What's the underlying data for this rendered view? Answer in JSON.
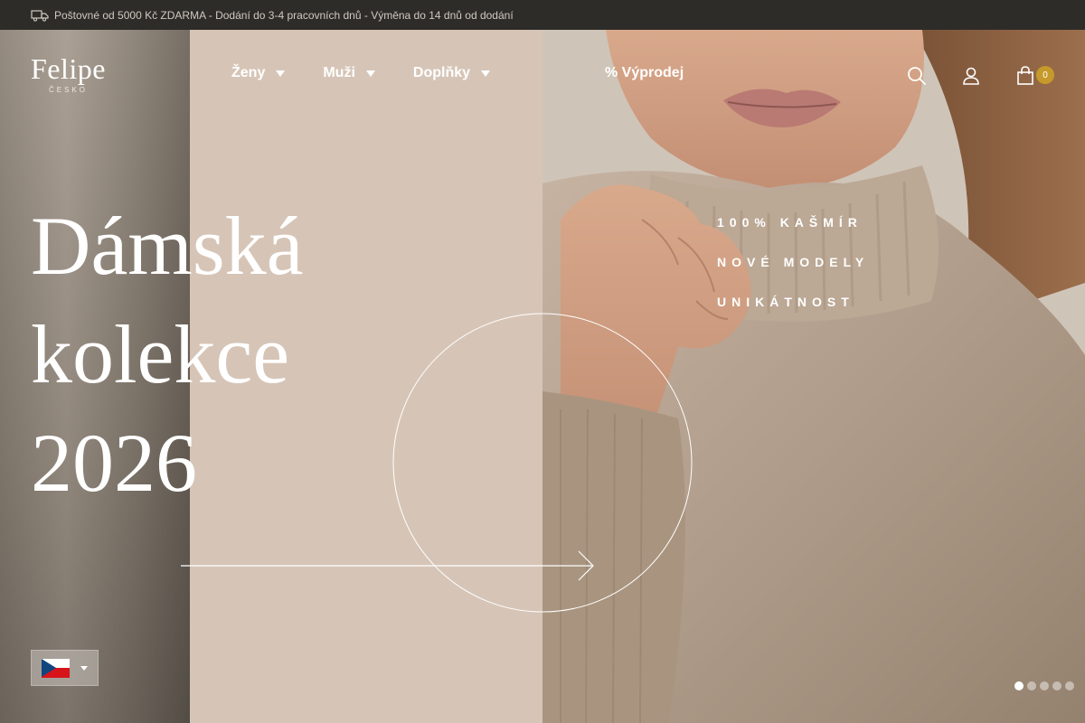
{
  "announcement": {
    "icon": "truck-icon",
    "text": "Poštovné od 5000 Kč ZDARMA - Dodání do 3-4 pracovních dnů - Výměna do 14 dnů od dodání"
  },
  "logo": {
    "name": "Felipe",
    "sub": "ČESKO"
  },
  "nav": {
    "items": [
      {
        "label": "Ženy"
      },
      {
        "label": "Muži"
      },
      {
        "label": "Doplňky"
      }
    ],
    "sale": {
      "icon": "percent-icon",
      "label": "% Výprodej"
    }
  },
  "header_icons": {
    "search": "search-icon",
    "account": "user-icon",
    "cart": "shopping-bag-icon",
    "cart_count": "0"
  },
  "hero": {
    "title_lines": [
      "Dámská",
      "kolekce",
      "2026"
    ],
    "features": [
      "100% KAŠMÍR",
      "NOVÉ MODELY",
      "UNIKÁTNOST"
    ]
  },
  "language": {
    "current": "CZ flag"
  },
  "carousel": {
    "slides": 5,
    "active": 1
  },
  "colors": {
    "accent": "#c59a2a",
    "panel": "#d6c5b7",
    "topbar": "#2e2c29"
  }
}
